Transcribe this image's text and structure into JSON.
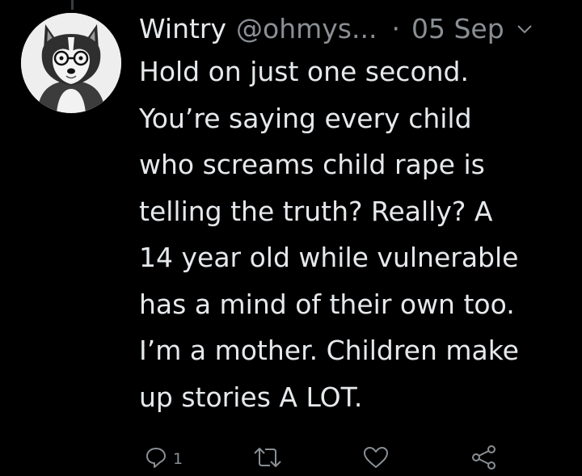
{
  "tweet": {
    "display_name": "Wintry",
    "handle": "@ohmys...",
    "separator": "·",
    "date": "05 Sep",
    "body_lines": [
      "Hold on just one second.",
      "You’re saying every child",
      "who screams child rape is",
      "telling the truth? Really? A",
      "14 year old while vulnerable",
      "has a mind of their own too.",
      "I’m a mother. Children make",
      "up stories A LOT."
    ],
    "avatar_icon": "husky-with-glasses-avatar",
    "menu_icon": "chevron-down-icon"
  },
  "actions": {
    "reply": {
      "icon": "reply-icon",
      "count": "1"
    },
    "retweet": {
      "icon": "retweet-icon"
    },
    "like": {
      "icon": "heart-icon"
    },
    "share": {
      "icon": "share-icon"
    }
  },
  "colors": {
    "background": "#000000",
    "text_primary": "#e6e9ec",
    "text_secondary": "#8a8f94"
  }
}
